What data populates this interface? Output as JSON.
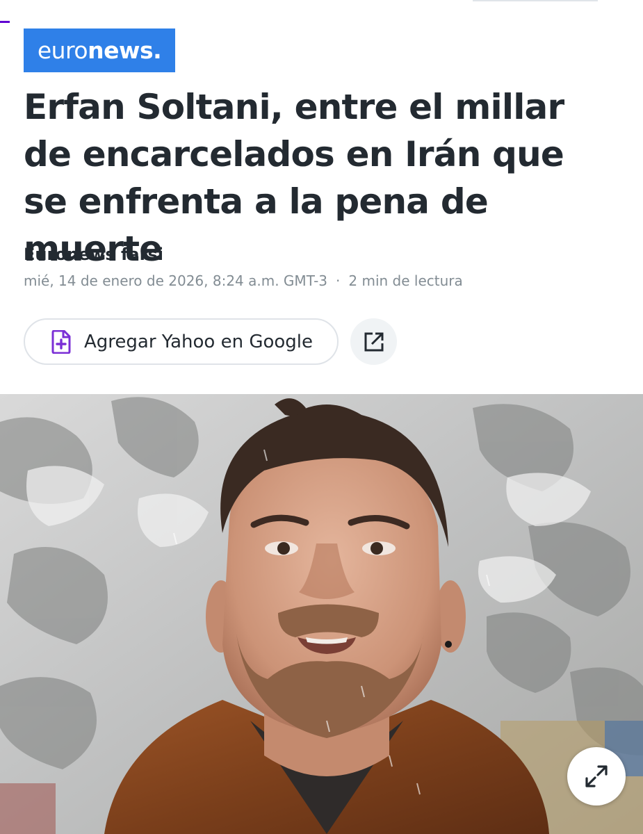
{
  "brand": {
    "logo_light": "euro",
    "logo_bold": "news",
    "logo_dot": ".",
    "color": "#2f80e8"
  },
  "article": {
    "headline": "Erfan Soltani, entre el millar de encarcelados en Irán que se enfrenta a la pena de muerte",
    "author": "Euronews farsi",
    "date": "mié, 14 de enero de 2026, 8:24 a.m. GMT-3",
    "separator": "·",
    "read_time": "2 min de lectura"
  },
  "actions": {
    "add_yahoo_label": "Agregar Yahoo en Google",
    "share_icon": "share-icon",
    "expand_icon": "expand-icon"
  },
  "accent_color": "#6001d2"
}
